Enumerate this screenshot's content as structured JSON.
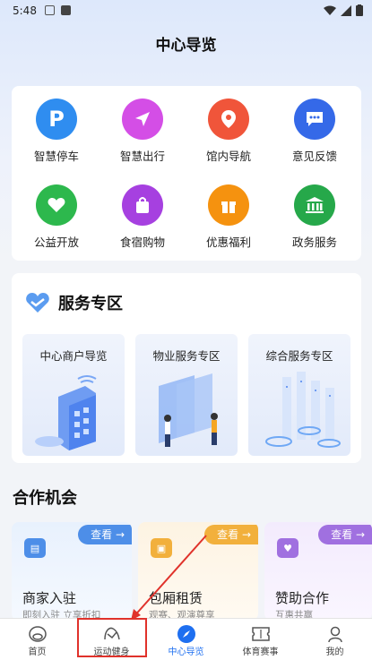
{
  "status_bar": {
    "time": "5:48"
  },
  "page": {
    "title": "中心导览"
  },
  "grid": [
    {
      "label": "智慧停车",
      "icon": "parking-icon",
      "color": "#2f8df0"
    },
    {
      "label": "智慧出行",
      "icon": "navigation-arrow-icon",
      "color": "#d44ee6"
    },
    {
      "label": "馆内导航",
      "icon": "map-pin-icon",
      "color": "#f0553a"
    },
    {
      "label": "意见反馈",
      "icon": "chat-bubble-icon",
      "color": "#3569e8"
    },
    {
      "label": "公益开放",
      "icon": "heart-hands-icon",
      "color": "#2db84d"
    },
    {
      "label": "食宿购物",
      "icon": "shopping-bag-icon",
      "color": "#a640e0"
    },
    {
      "label": "优惠福利",
      "icon": "gift-icon",
      "color": "#f5920f"
    },
    {
      "label": "政务服务",
      "icon": "government-building-icon",
      "color": "#26a84a"
    }
  ],
  "services": {
    "title": "服务专区",
    "cards": [
      {
        "label": "中心商户导览"
      },
      {
        "label": "物业服务专区"
      },
      {
        "label": "综合服务专区"
      }
    ]
  },
  "cooperation": {
    "title": "合作机会",
    "cards": [
      {
        "tag": "查看 →",
        "title": "商家入驻",
        "subtitle": "即刻入驻 立享折扣",
        "color": "#4d8ee8",
        "bg": "#e8f1fd"
      },
      {
        "tag": "查看 →",
        "title": "包厢租赁",
        "subtitle": "观赛、观演尊享",
        "color": "#f2b03c",
        "bg": "#fdf3e2"
      },
      {
        "tag": "查看 →",
        "title": "赞助合作",
        "subtitle": "互惠共赢",
        "color": "#a070e0",
        "bg": "#f3ebfd"
      }
    ]
  },
  "tabs": [
    {
      "label": "首页",
      "active": false
    },
    {
      "label": "运动健身",
      "active": false
    },
    {
      "label": "中心导览",
      "active": true
    },
    {
      "label": "体育赛事",
      "active": false
    },
    {
      "label": "我的",
      "active": false
    }
  ],
  "colors": {
    "accent": "#1e6ff0",
    "highlight": "#e0322b"
  }
}
